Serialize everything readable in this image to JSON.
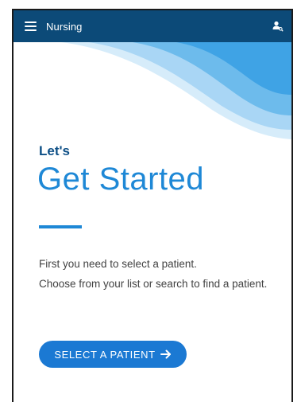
{
  "app_bar": {
    "title": "Nursing"
  },
  "hero": {
    "kicker": "Let's",
    "headline": "Get Started"
  },
  "body": {
    "line1": "First you need to select a patient.",
    "line2": "Choose from your list or search to find a patient."
  },
  "cta": {
    "label": "SELECT A PATIENT"
  },
  "icons": {
    "menu": "menu-icon",
    "user": "user-search-icon",
    "arrow": "arrow-right-icon"
  },
  "colors": {
    "app_bar": "#0c4a78",
    "accent": "#1e88d6",
    "kicker": "#0d4f86",
    "button": "#1b79d3",
    "text": "#424242"
  }
}
